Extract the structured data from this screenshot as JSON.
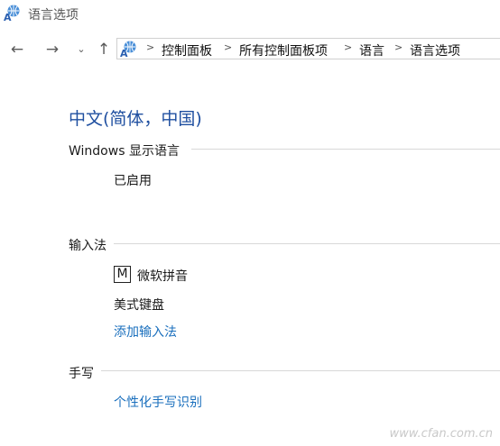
{
  "window": {
    "title": "语言选项"
  },
  "nav": {
    "back": "←",
    "forward": "→",
    "recent": "⌄",
    "up": "↑"
  },
  "breadcrumbs": [
    {
      "label": "控制面板"
    },
    {
      "label": "所有控制面板项"
    },
    {
      "label": "语言"
    },
    {
      "label": "语言选项"
    }
  ],
  "language": {
    "title": "中文(简体，中国)"
  },
  "display_language": {
    "header": "Windows 显示语言",
    "status": "已启用"
  },
  "input_methods": {
    "header": "输入法",
    "ime_badge": "M",
    "items": [
      {
        "label": "微软拼音"
      },
      {
        "label": "美式键盘"
      }
    ],
    "add_link": "添加输入法"
  },
  "handwriting": {
    "header": "手写",
    "link": "个性化手写识别"
  },
  "watermark": "www.cfan.com.cn",
  "colors": {
    "accent": "#1f4fa0",
    "link": "#1a6fbd"
  }
}
